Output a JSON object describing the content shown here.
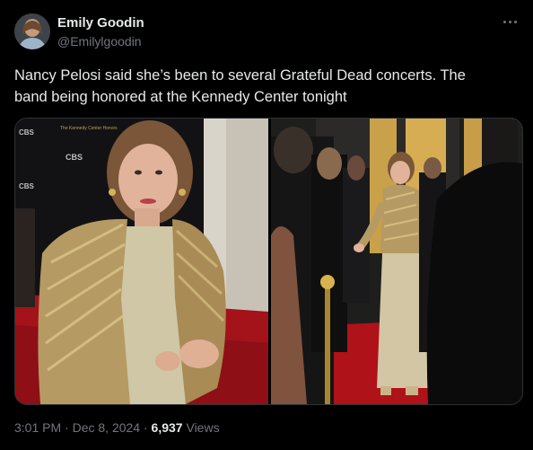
{
  "author": {
    "name": "Emily Goodin",
    "handle": "@Emilylgoodin"
  },
  "tweet": {
    "text_line1": "Nancy Pelosi said she’s been to several Grateful Dead concerts. The",
    "text_line2": "band being honored at the Kennedy Center tonight"
  },
  "media": {
    "backdrop_logo": "CBS",
    "backdrop_text": "The Kennedy Center Honors"
  },
  "meta": {
    "time": "3:01 PM",
    "separator": "·",
    "date": "Dec 8, 2024",
    "separator2": "·",
    "views_count": "6,937",
    "views_label": "Views"
  },
  "colors": {
    "background": "#000000",
    "text_primary": "#e7e9ea",
    "text_secondary": "#71767b",
    "border": "#2f3336"
  }
}
